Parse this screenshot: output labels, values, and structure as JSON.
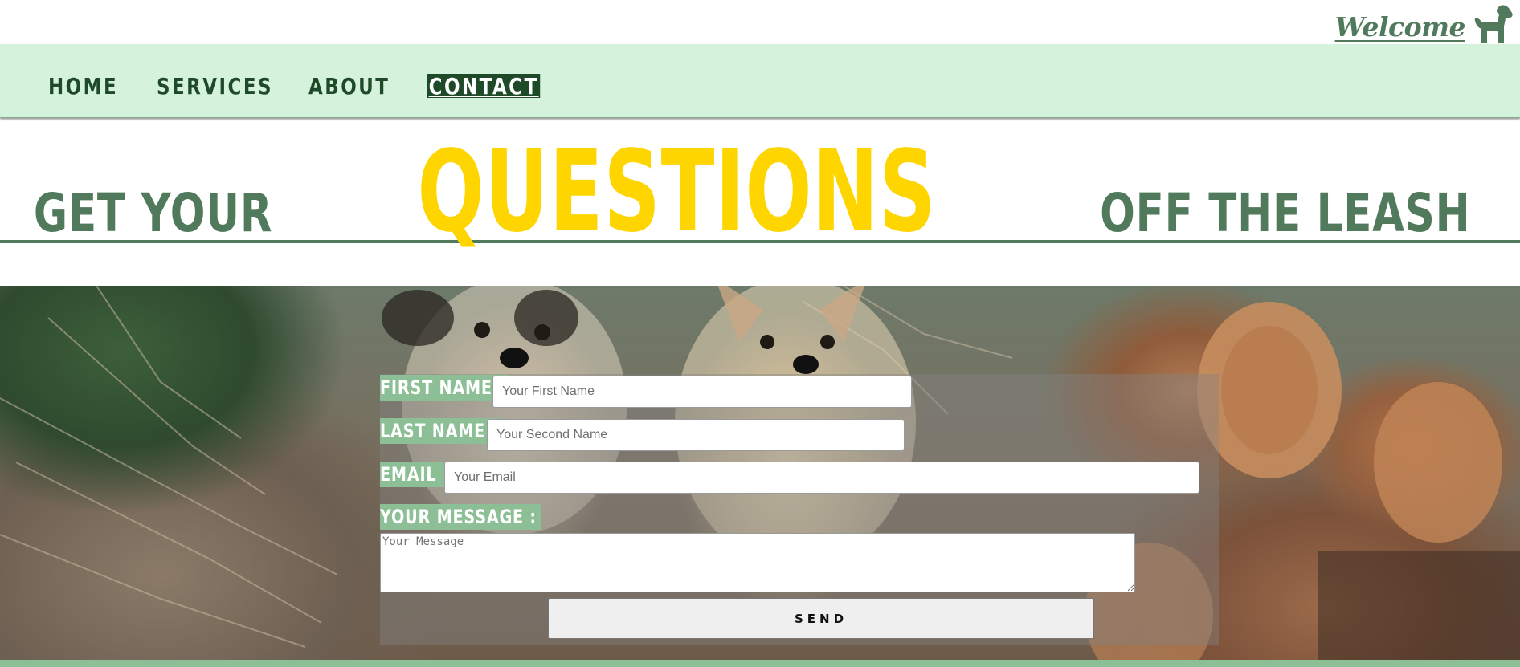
{
  "header": {
    "welcome_text": "Welcome",
    "logo_icon": "dog-icon"
  },
  "nav": {
    "items": [
      {
        "label": "HOME",
        "active": false
      },
      {
        "label": "SERVICES",
        "active": false
      },
      {
        "label": "ABOUT",
        "active": false
      },
      {
        "label": "CONTACT",
        "active": true
      }
    ]
  },
  "headline": {
    "part1": "GET YOUR",
    "highlight": "QUESTIONS",
    "part2": "OFF THE LEASH"
  },
  "form": {
    "first_name_label": "FIRST NAME :",
    "first_name_placeholder": "Your First Name",
    "last_name_label": "LAST NAME :",
    "last_name_placeholder": "Your Second Name",
    "email_label": "EMAIL :",
    "email_placeholder": "Your Email",
    "message_label": "YOUR MESSAGE :",
    "message_placeholder": "Your Message",
    "send_label": "SEND"
  },
  "colors": {
    "nav_background": "#d5f2dc",
    "nav_text": "#1f4a2a",
    "headline_green": "#517a5c",
    "headline_yellow": "#ffd500",
    "label_background": "#8dbf96"
  }
}
